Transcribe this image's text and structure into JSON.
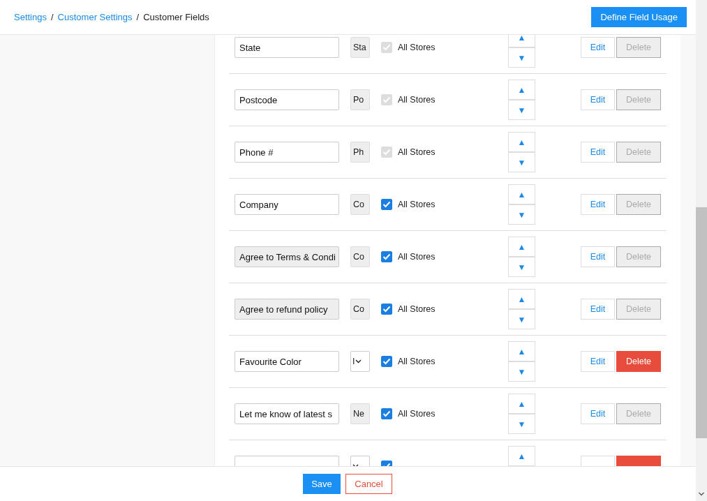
{
  "breadcrumb": [
    {
      "label": "Settings",
      "link": true
    },
    {
      "label": "Customer Settings",
      "link": true
    },
    {
      "label": "Customer Fields",
      "link": false
    }
  ],
  "separator": "/",
  "header_button": "Define Field Usage",
  "fields": [
    {
      "name": "State",
      "name_disabled": false,
      "dropdown": false,
      "type": "Sta",
      "all_stores": "All Stores",
      "checked": true,
      "check_disabled": true,
      "move_up": "▲",
      "move_down": "▼",
      "edit": "Edit",
      "delete": "Delete",
      "delete_enabled": false
    },
    {
      "name": "Postcode",
      "name_disabled": false,
      "dropdown": false,
      "type": "Po",
      "all_stores": "All Stores",
      "checked": true,
      "check_disabled": true,
      "move_up": "▲",
      "move_down": "▼",
      "edit": "Edit",
      "delete": "Delete",
      "delete_enabled": false
    },
    {
      "name": "Phone #",
      "name_disabled": false,
      "dropdown": false,
      "type": "Ph",
      "all_stores": "All Stores",
      "checked": true,
      "check_disabled": true,
      "move_up": "▲",
      "move_down": "▼",
      "edit": "Edit",
      "delete": "Delete",
      "delete_enabled": false
    },
    {
      "name": "Company",
      "name_disabled": false,
      "dropdown": false,
      "type": "Co",
      "all_stores": "All Stores",
      "checked": true,
      "check_disabled": false,
      "move_up": "▲",
      "move_down": "▼",
      "edit": "Edit",
      "delete": "Delete",
      "delete_enabled": false
    },
    {
      "name": "Agree to Terms & Condi",
      "name_disabled": true,
      "dropdown": false,
      "type": "Co",
      "all_stores": "All Stores",
      "checked": true,
      "check_disabled": false,
      "move_up": "▲",
      "move_down": "▼",
      "edit": "Edit",
      "delete": "Delete",
      "delete_enabled": false
    },
    {
      "name": "Agree to refund policy",
      "name_disabled": true,
      "dropdown": false,
      "type": "Co",
      "all_stores": "All Stores",
      "checked": true,
      "check_disabled": false,
      "move_up": "▲",
      "move_down": "▼",
      "edit": "Edit",
      "delete": "Delete",
      "delete_enabled": false
    },
    {
      "name": "Favourite Color",
      "name_disabled": false,
      "dropdown": true,
      "type": "I",
      "all_stores": "All Stores",
      "checked": true,
      "check_disabled": false,
      "move_up": "▲",
      "move_down": "▼",
      "edit": "Edit",
      "delete": "Delete",
      "delete_enabled": true
    },
    {
      "name": "Let me know of latest s",
      "name_disabled": false,
      "dropdown": false,
      "type": "Ne",
      "all_stores": "All Stores",
      "checked": true,
      "check_disabled": false,
      "move_up": "▲",
      "move_down": "▼",
      "edit": "Edit",
      "delete": "Delete",
      "delete_enabled": false
    },
    {
      "name_disabled": false,
      "dropdown": true,
      "checked": true,
      "check_disabled": false,
      "move_up": "▲",
      "delete_enabled": true
    }
  ],
  "footer": {
    "save": "Save",
    "cancel": "Cancel"
  }
}
